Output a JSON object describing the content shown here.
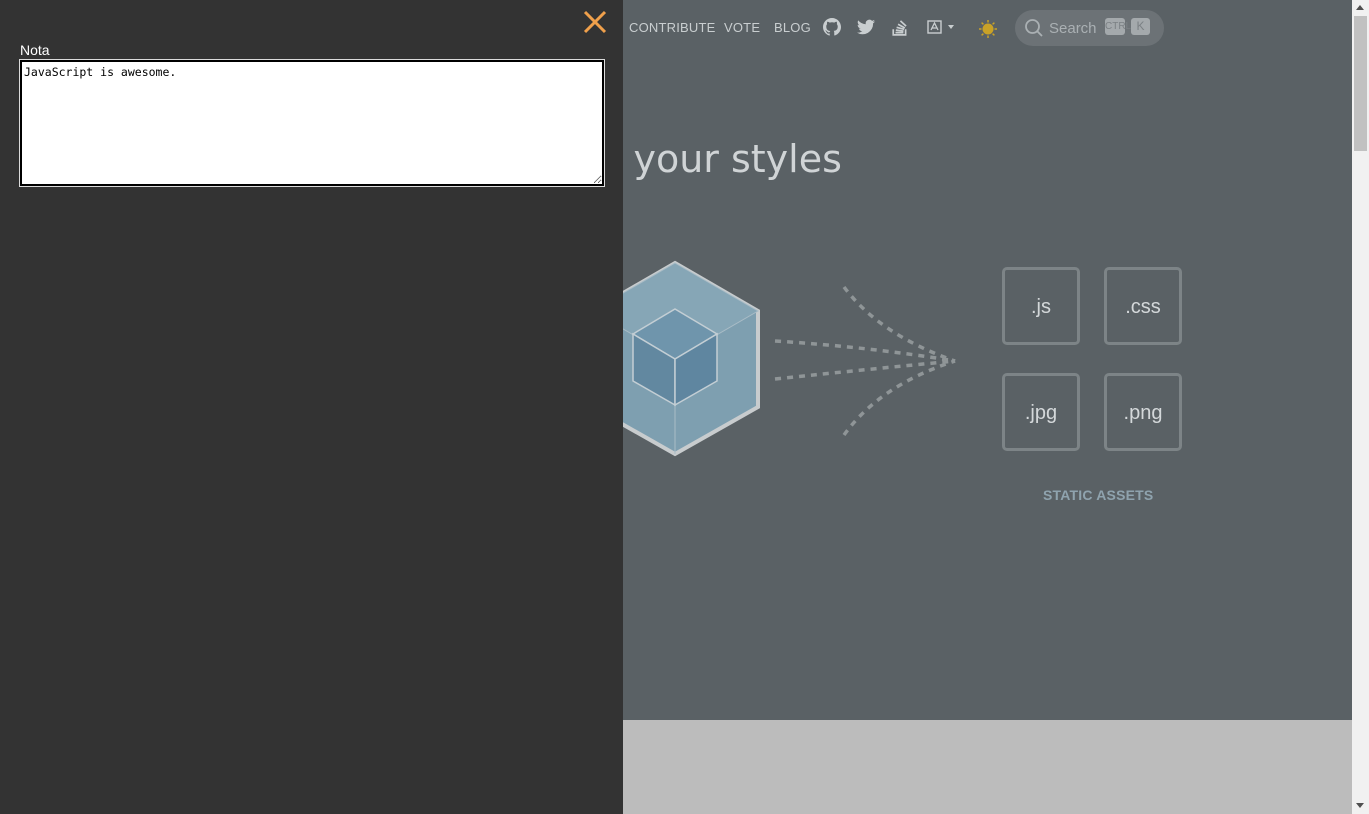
{
  "nav": {
    "links": [
      "CONTRIBUTE",
      "VOTE",
      "BLOG"
    ],
    "icons": [
      "github-icon",
      "twitter-icon",
      "stackoverflow-icon",
      "language-icon",
      "theme-toggle-icon"
    ]
  },
  "search": {
    "placeholder": "Search",
    "key_ctrl": "CTRL",
    "key_k": "K"
  },
  "hero": {
    "headline": "e your styles"
  },
  "assets": {
    "items": [
      ".js",
      ".css",
      ".jpg",
      ".png"
    ],
    "label": "STATIC ASSETS"
  },
  "panel": {
    "label": "Nota",
    "textarea_value": "JavaScript is awesome."
  },
  "colors": {
    "panel_bg": "#333333",
    "close_accent": "#f0a04b",
    "page_bg": "#5a6165"
  }
}
